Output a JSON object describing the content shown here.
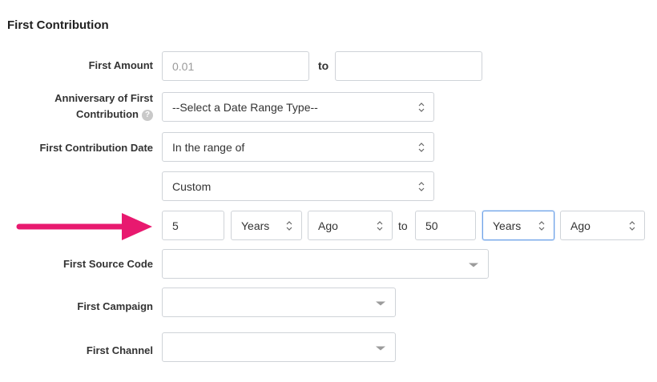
{
  "section": {
    "title": "First Contribution"
  },
  "first_amount": {
    "label": "First Amount",
    "from_placeholder": "0.01",
    "from_value": "",
    "to_label": "to",
    "to_value": ""
  },
  "anniversary": {
    "label_line1": "Anniversary of First",
    "label_line2": "Contribution",
    "help_icon": "?",
    "selected": "--Select a Date Range Type--"
  },
  "contribution_date": {
    "label": "First Contribution Date",
    "range_type": "In the range of",
    "custom_type": "Custom",
    "from_number": "5",
    "from_unit": "Years",
    "from_direction": "Ago",
    "to_label": "to",
    "to_number": "50",
    "to_unit": "Years",
    "to_direction": "Ago"
  },
  "source_code": {
    "label": "First Source Code",
    "selected": ""
  },
  "campaign": {
    "label": "First Campaign",
    "selected": ""
  },
  "channel": {
    "label": "First Channel",
    "selected": ""
  },
  "annotation": {
    "arrow_color": "#e8196f",
    "icon": "arrow-right-icon"
  },
  "colors": {
    "focus_border": "#6fa3e8",
    "field_border": "#cfd3d8"
  }
}
